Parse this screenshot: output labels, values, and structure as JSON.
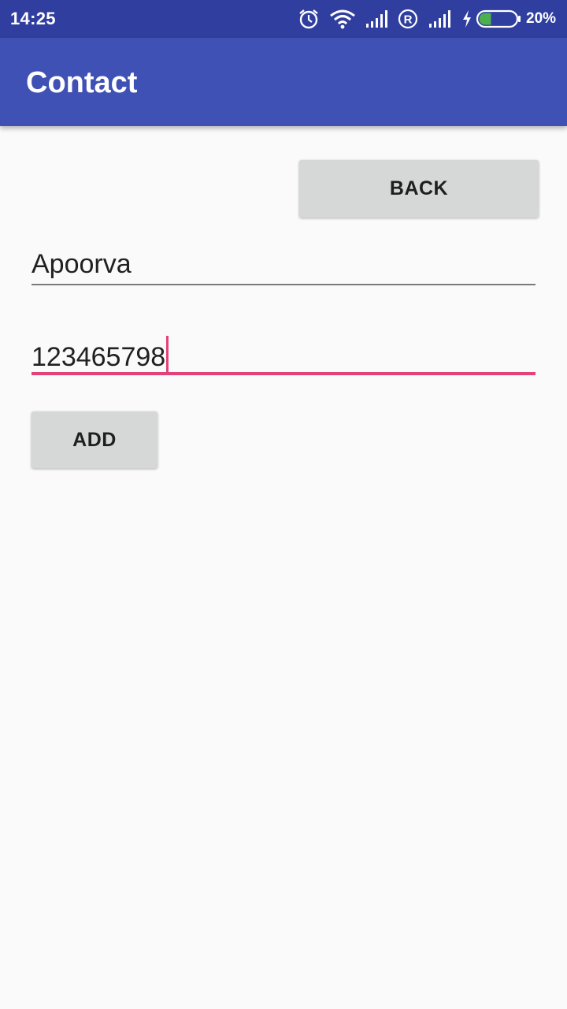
{
  "status_bar": {
    "time": "14:25",
    "battery_percent": "20%",
    "icons": [
      "alarm-icon",
      "wifi-icon",
      "signal-icon",
      "roaming-icon",
      "signal-icon",
      "charging-icon",
      "battery-icon"
    ],
    "battery_level": 0.2,
    "battery_color": "#4caf50"
  },
  "app_bar": {
    "title": "Contact",
    "color": "#3f51b5"
  },
  "back_button": {
    "label": "BACK"
  },
  "name_field": {
    "value": "Apoorva"
  },
  "phone_field": {
    "value": "123465798",
    "focused": true,
    "accent_color": "#e2417a"
  },
  "add_button": {
    "label": "ADD"
  }
}
